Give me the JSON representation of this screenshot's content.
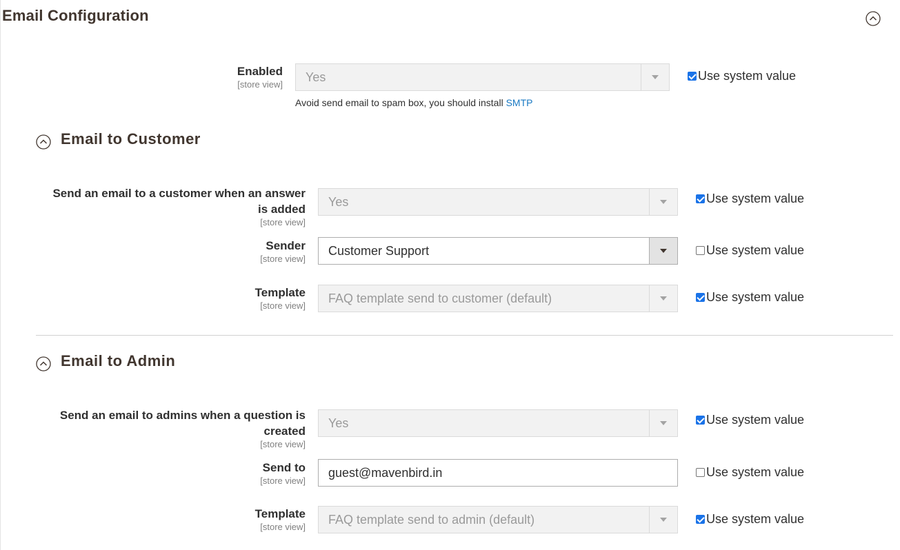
{
  "header": {
    "title": "Email Configuration"
  },
  "general": {
    "enabled": {
      "label": "Enabled",
      "scope": "[store view]",
      "value": "Yes",
      "use_system_value": "Use system value",
      "use_system_checked": true
    },
    "note": {
      "text": "Avoid send email to spam box, you should install ",
      "link": "SMTP"
    }
  },
  "customer": {
    "title": "Email to Customer",
    "send_email": {
      "label_line1": "Send an email to a customer when an answer",
      "label_line2": "is added",
      "scope": "[store view]",
      "value": "Yes",
      "use_system_value": "Use system value",
      "use_system_checked": true
    },
    "sender": {
      "label": "Sender",
      "scope": "[store view]",
      "value": "Customer Support",
      "use_system_value": "Use system value",
      "use_system_checked": false
    },
    "template": {
      "label": "Template",
      "scope": "[store view]",
      "value": "FAQ template send to customer (default)",
      "use_system_value": "Use system value",
      "use_system_checked": true
    }
  },
  "admin": {
    "title": "Email to Admin",
    "send_email": {
      "label_line1": "Send an email to admins when a question is",
      "label_line2": "created",
      "scope": "[store view]",
      "value": "Yes",
      "use_system_value": "Use system value",
      "use_system_checked": true
    },
    "send_to": {
      "label": "Send to",
      "scope": "[store view]",
      "value": "guest@mavenbird.in",
      "use_system_value": "Use system value",
      "use_system_checked": false
    },
    "template": {
      "label": "Template",
      "scope": "[store view]",
      "value": "FAQ template send to admin (default)",
      "use_system_value": "Use system value",
      "use_system_checked": true
    }
  },
  "icons": {
    "collapse": "chevron-up-circle-icon"
  },
  "colors": {
    "title": "#41362f",
    "link": "#1979c3",
    "checkbox_checked": "#1a73e8",
    "disabled_bg": "#f2f2f2"
  }
}
